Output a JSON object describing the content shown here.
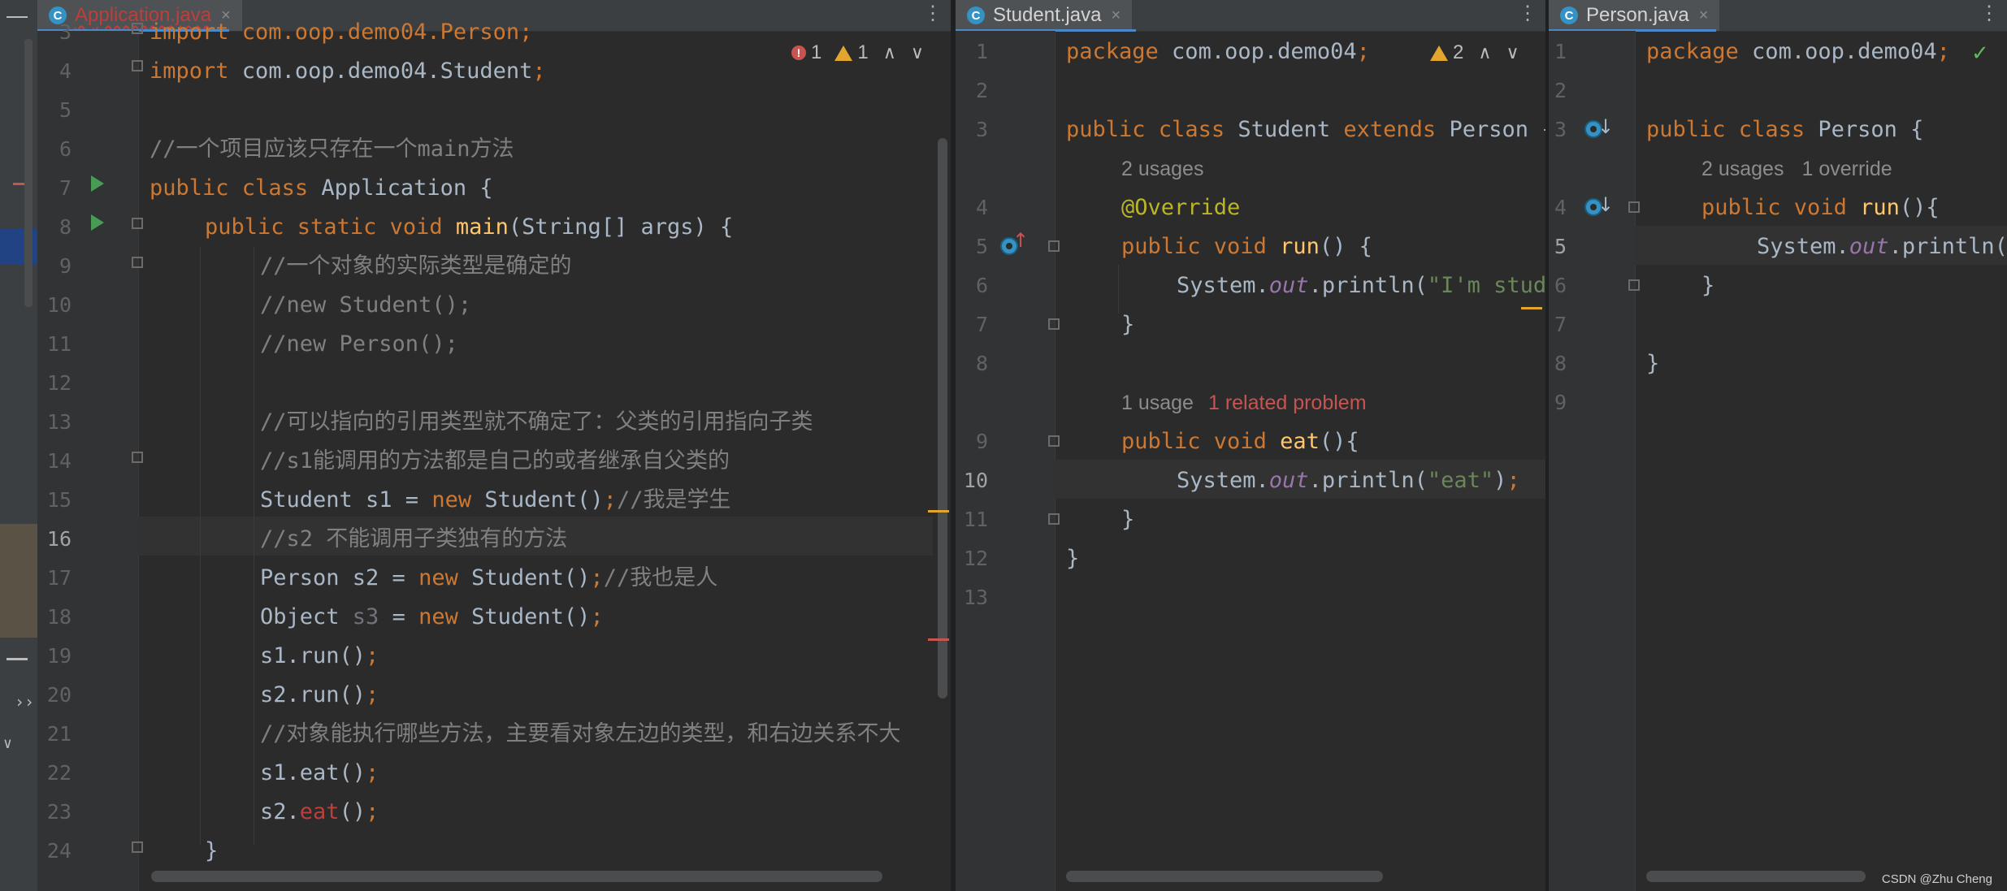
{
  "colors": {
    "background": "#2b2b2b",
    "gutter": "#313335",
    "keyword": "#cc7832",
    "comment": "#808080",
    "string": "#6a8759",
    "function": "#ffc66d",
    "annotation": "#bbb529",
    "field": "#9876aa",
    "error": "#bc3f3c",
    "run_icon": "#499c54",
    "class_icon": "#3592c4"
  },
  "panes": {
    "application": {
      "tab_label": "Application.java",
      "tab_icon_letter": "C",
      "tab_close": "×",
      "menu": "⋮",
      "inspections": {
        "errors": "1",
        "warnings": "1",
        "up": "∧",
        "down": "∨"
      },
      "line_numbers": [
        "3",
        "4",
        "5",
        "6",
        "7",
        "8",
        "9",
        "10",
        "11",
        "12",
        "13",
        "14",
        "15",
        "16",
        "17",
        "18",
        "19",
        "20",
        "21",
        "22",
        "23",
        "24"
      ],
      "current_line": "16",
      "code": {
        "l3": "import com.oop.demo04.Person;",
        "l4_import": "import",
        "l4_pkg": " com.oop.demo04.Student",
        "l4_semi": ";",
        "l6": "//一个项目应该只存在一个main方法",
        "l7_public": "public",
        "l7_class": " class",
        "l7_rest": " Application {",
        "l8_public": "public",
        "l8_static": " static",
        "l8_void": " void",
        "l8_main": " main",
        "l8_rest": "(String[] args) {",
        "l9": "//一个对象的实际类型是确定的",
        "l10": "//new Student();",
        "l11": "//new Person();",
        "l13": "//可以指向的引用类型就不确定了：父类的引用指向子类",
        "l14": "//s1能调用的方法都是自己的或者继承自父类的",
        "l15_a": "Student s1 = ",
        "l15_new": "new",
        "l15_b": " Student()",
        "l15_semi": ";",
        "l15_cm": "//我是学生",
        "l16": "//s2 不能调用子类独有的方法",
        "l17_a": "Person s2 = ",
        "l17_new": "new",
        "l17_b": " Student()",
        "l17_semi": ";",
        "l17_cm": "//我也是人",
        "l18_a": "Object ",
        "l18_var": "s3",
        "l18_b": " = ",
        "l18_new": "new",
        "l18_c": " Student()",
        "l18_semi": ";",
        "l19_a": "s1.run()",
        "l19_semi": ";",
        "l20_a": "s2.run()",
        "l20_semi": ";",
        "l21": "//对象能执行哪些方法，主要看对象左边的类型，和右边关系不大",
        "l22_a": "s1.eat()",
        "l22_semi": ";",
        "l23_a": "s2.",
        "l23_err": "eat",
        "l23_b": "()",
        "l23_semi": ";",
        "l24": "}"
      }
    },
    "student": {
      "tab_label": "Student.java",
      "tab_icon_letter": "C",
      "tab_close": "×",
      "menu": "⋮",
      "inspections": {
        "warnings": "2",
        "up": "∧",
        "down": "∨"
      },
      "line_numbers": [
        "1",
        "2",
        "3",
        "4",
        "5",
        "6",
        "7",
        "8",
        "9",
        "10",
        "11",
        "12",
        "13"
      ],
      "current_line": "10",
      "hints": {
        "usages_run": "2 usages",
        "usages_eat": "1 usage",
        "problem": "1 related problem"
      },
      "code": {
        "l1_kw": "package",
        "l1_pkg": " com.oop.demo04",
        "l1_semi": ";",
        "l3_public": "public",
        "l3_class": " class",
        "l3_name": " Student",
        "l3_extends": " extends",
        "l3_parent": " Person {",
        "l4": "@Override",
        "l5_public": "public",
        "l5_void": " void",
        "l5_fn": " run",
        "l5_rest": "() {",
        "l6_a": "System.",
        "l6_out": "out",
        "l6_b": ".println(",
        "l6_str": "\"I'm student\"",
        "l6_c": ");",
        "l7": "}",
        "l9_public": "public",
        "l9_void": " void",
        "l9_fn": " eat",
        "l9_rest": "(){",
        "l10_a": "System.",
        "l10_out": "out",
        "l10_b": ".println(",
        "l10_str": "\"eat\"",
        "l10_c": ")",
        "l10_semi": ";",
        "l11": "}",
        "l12": "}"
      }
    },
    "person": {
      "tab_label": "Person.java",
      "tab_icon_letter": "C",
      "tab_close": "×",
      "menu": "⋮",
      "inspections": {
        "ok": "✓"
      },
      "line_numbers": [
        "1",
        "2",
        "3",
        "4",
        "5",
        "6",
        "7",
        "8",
        "9"
      ],
      "current_line": "5",
      "hints": {
        "usages": "2 usages",
        "override": "1 override"
      },
      "code": {
        "l1_kw": "package",
        "l1_pkg": " com.oop.demo04",
        "l1_semi": ";",
        "l3_public": "public",
        "l3_class": " class",
        "l3_name": " Person {",
        "l4_public": "public",
        "l4_void": " void",
        "l4_fn": " run",
        "l4_rest": "(){",
        "l5_a": "System.",
        "l5_out": "out",
        "l5_b": ".println(",
        "l6": "}",
        "l8": "}"
      }
    }
  },
  "watermark": "CSDN @Zhu Cheng"
}
